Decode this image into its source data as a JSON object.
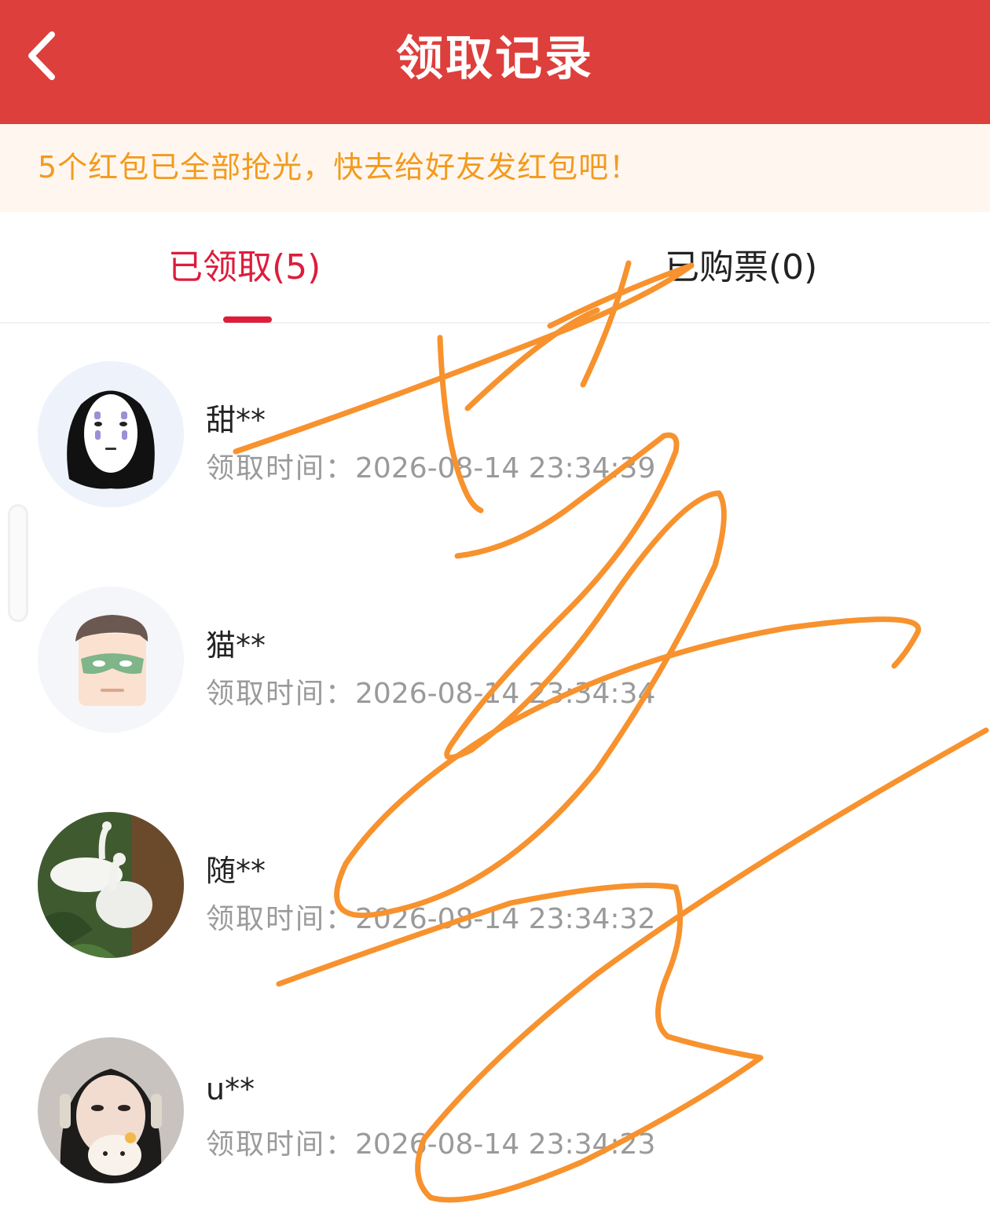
{
  "header": {
    "title": "领取记录",
    "background_color": "#dd3f3c",
    "back_icon": "chevron-left-icon"
  },
  "notice": {
    "text": "5个红包已全部抢光，快去给好友发红包吧！",
    "text_color": "#f39a1e"
  },
  "tabs": [
    {
      "label": "已领取(5)",
      "active": true
    },
    {
      "label": "已购票(0)",
      "active": false
    }
  ],
  "accent_color": "#dc1d3c",
  "records": [
    {
      "name": "甜**",
      "time_label": "领取时间：",
      "time": "2026-08-14 23:34:39",
      "avatar": "no-face-avatar"
    },
    {
      "name": "猫**",
      "time_label": "领取时间：",
      "time": "2026-08-14 23:34:34",
      "avatar": "masked-man-avatar"
    },
    {
      "name": "随**",
      "time_label": "领取时间：",
      "time": "2026-08-14 23:34:32",
      "avatar": "white-peacock-avatar"
    },
    {
      "name": "u**",
      "time_label": "领取时间：",
      "time": "2026-08-14 23:34:23",
      "avatar": "girl-with-headphones-avatar"
    }
  ],
  "overlay": {
    "description_icon": "scribble-overlay",
    "stroke_color": "#f7922e"
  }
}
